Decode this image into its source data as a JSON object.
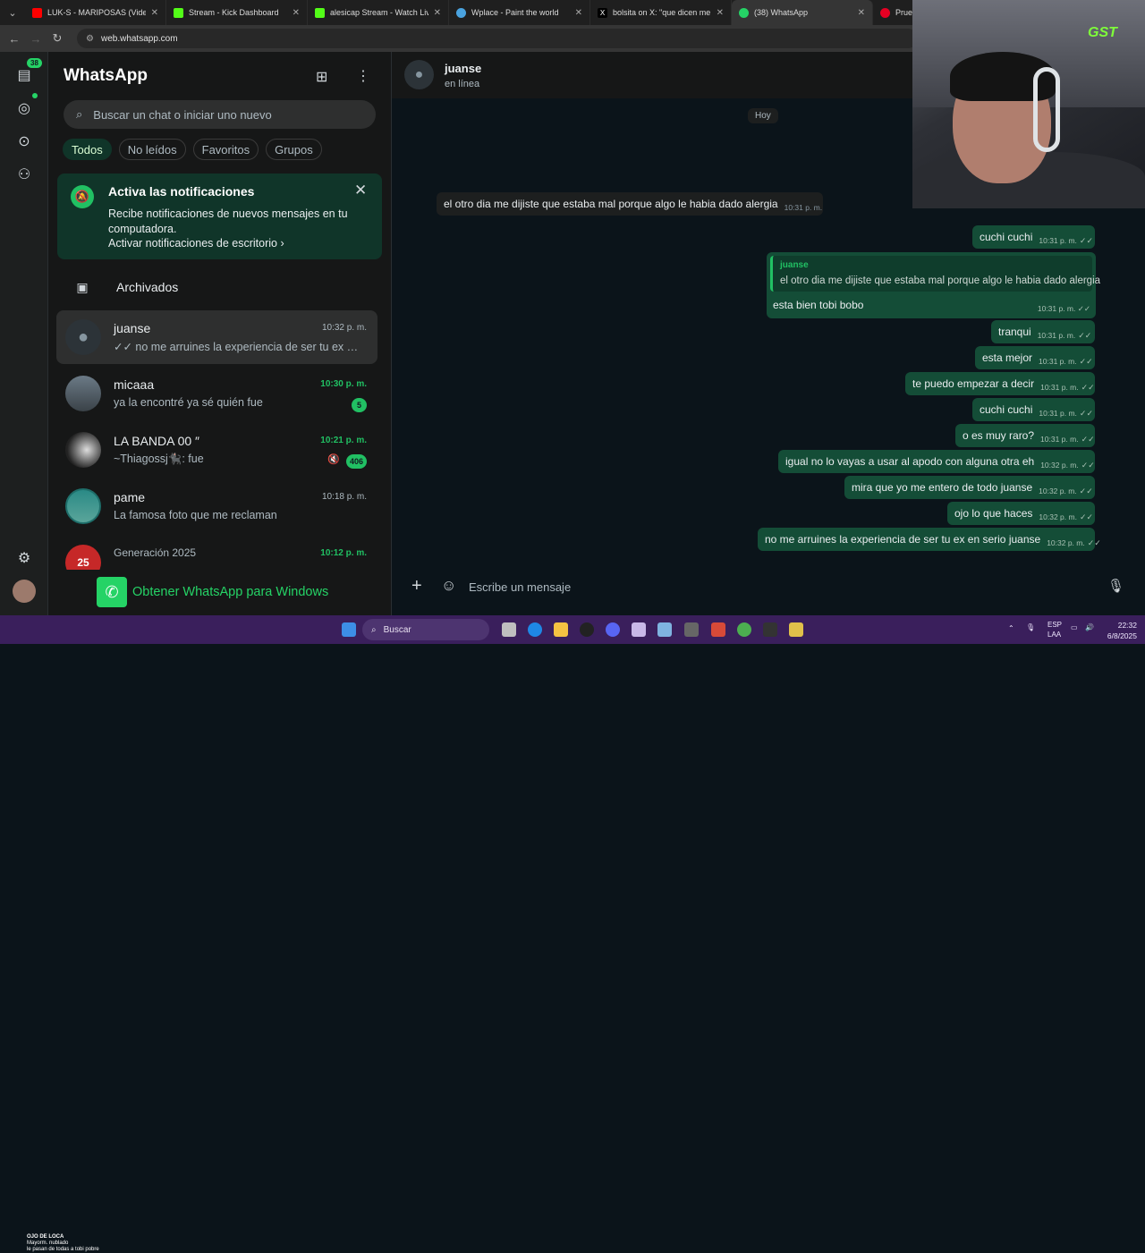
{
  "browser": {
    "tabs": [
      {
        "title": "LUK-S - MARIPOSAS (Video Of",
        "favicon_color": "#ff0000"
      },
      {
        "title": "Stream - Kick Dashboard",
        "favicon_color": "#53fc18"
      },
      {
        "title": "alesicap Stream - Watch Live o",
        "favicon_color": "#53fc18"
      },
      {
        "title": "Wplace - Paint the world",
        "favicon_color": "#4aa3df"
      },
      {
        "title": "bolsita on X: \"que dicen me sac",
        "favicon_color": "#ffffff"
      },
      {
        "title": "(38) WhatsApp",
        "favicon_color": "#25d366"
      },
      {
        "title": "Prueba",
        "favicon_color": "#e60023"
      }
    ],
    "url": "web.whatsapp.com"
  },
  "rail": {
    "unread_badge": "38"
  },
  "sidebar": {
    "title": "WhatsApp",
    "search_placeholder": "Buscar un chat o iniciar uno nuevo",
    "filters": [
      "Todos",
      "No leídos",
      "Favoritos",
      "Grupos"
    ],
    "notification": {
      "heading": "Activa las notificaciones",
      "body": "Recibe notificaciones de nuevos mensajes en tu computadora.",
      "link": "Activar notificaciones de escritorio"
    },
    "archived_label": "Archivados",
    "chats": [
      {
        "name": "juanse",
        "time": "10:32 p. m.",
        "preview": "✓✓ no me arruines la experiencia de ser tu ex en seri...",
        "unread": ""
      },
      {
        "name": "micaaa",
        "time": "10:30 p. m.",
        "preview": "ya la encontré ya sé quién fue",
        "unread": "5"
      },
      {
        "name": "LA BANDA 00 ″",
        "time": "10:21 p. m.",
        "preview": "~Thiagossj🐈‍⬛: fue",
        "unread": "406"
      },
      {
        "name": "pame",
        "time": "10:18 p. m.",
        "preview": "La famosa foto que me reclaman",
        "unread": ""
      },
      {
        "name": "Generación 2025",
        "time": "10:12 p. m.",
        "preview": "",
        "unread": ""
      }
    ],
    "get_windows": "Obtener WhatsApp para Windows"
  },
  "chat": {
    "contact_name": "juanse",
    "status": "en línea",
    "day_separator": "Hoy",
    "incoming": {
      "text": "el otro dia me dijiste que estaba mal porque algo le habia dado alergia",
      "time": "10:31 p. m."
    },
    "reply": {
      "quoted_name": "juanse",
      "quoted_text": "el otro dia me dijiste que estaba mal porque algo le habia dado alergia",
      "text": "esta bien tobi bobo",
      "time": "10:31 p. m."
    },
    "outgoing": [
      {
        "text": "cuchi cuchi",
        "time": "10:31 p. m."
      },
      {
        "text": "tranqui",
        "time": "10:31 p. m."
      },
      {
        "text": "esta mejor",
        "time": "10:31 p. m."
      },
      {
        "text": "te puedo empezar a decir",
        "time": "10:31 p. m."
      },
      {
        "text": "cuchi cuchi",
        "time": "10:31 p. m."
      },
      {
        "text": "o es muy raro?",
        "time": "10:31 p. m."
      },
      {
        "text": "igual no lo vayas  a usar al apodo con alguna otra eh",
        "time": "10:32 p. m."
      },
      {
        "text": "mira que yo me entero de todo juanse",
        "time": "10:32 p. m."
      },
      {
        "text": "ojo lo que haces",
        "time": "10:32 p. m."
      },
      {
        "text": "no me arruines la experiencia de ser tu ex en serio juanse",
        "time": "10:32 p. m."
      }
    ],
    "composer_placeholder": "Escribe un mensaje"
  },
  "webcam": {
    "logo": "GST"
  },
  "taskbar": {
    "search": "Buscar",
    "lang1": "ESP",
    "lang2": "LAA",
    "time": "22:32",
    "date": "6/8/2025",
    "weather_line1": "OJO DE LOCA",
    "weather_line2": "Mayorm. nublado",
    "overlay_text": "le pasan de todas a tobi pobre"
  }
}
